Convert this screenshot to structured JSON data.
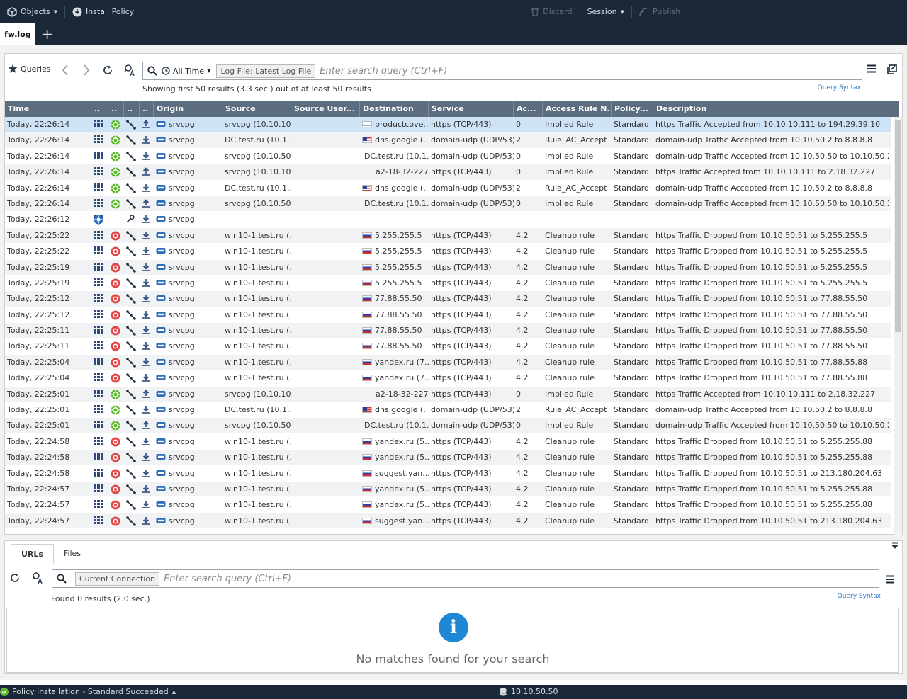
{
  "topbar": {
    "objects_label": "Objects",
    "install_policy_label": "Install Policy",
    "discard_label": "Discard",
    "session_label": "Session",
    "publish_label": "Publish"
  },
  "tab": {
    "name": "fw.log",
    "add": "+"
  },
  "toolbar": {
    "queries_label": "Queries",
    "time_filter": "All Time",
    "log_file_tag": "Log File: Latest Log File",
    "search_placeholder": "Enter search query (Ctrl+F)",
    "results_status": "Showing first 50 results (3.3 sec.) out of at least 50 results",
    "query_syntax_link": "Query Syntax"
  },
  "table": {
    "columns": [
      "Time",
      "..",
      "..",
      "..",
      "..",
      "Origin",
      "Source",
      "Source User...",
      "Destination",
      "Service",
      "Ac...",
      "Access Rule N...",
      "Policy...",
      "Description"
    ],
    "rows": [
      {
        "time": "Today, 22:26:14",
        "status": "accept",
        "dir": "up",
        "origin": "srvcpg",
        "source": "srvcpg (10.10.10....",
        "flag": "il",
        "destination": "productcove...",
        "service": "https (TCP/443)",
        "ac": "0",
        "rule": "Implied Rule",
        "policy": "Standard",
        "description": "https Traffic Accepted from 10.10.10.111 to 194.29.39.10"
      },
      {
        "time": "Today, 22:26:14",
        "status": "accept",
        "dir": "down",
        "origin": "srvcpg",
        "source": "DC.test.ru (10.1....",
        "flag": "us",
        "destination": "dns.google (...",
        "service": "domain-udp (UDP/53)",
        "ac": "2",
        "rule": "Rule_AC_Accept",
        "policy": "Standard",
        "description": "domain-udp Traffic Accepted from 10.10.50.2 to 8.8.8.8"
      },
      {
        "time": "Today, 22:26:14",
        "status": "accept",
        "dir": "down",
        "origin": "srvcpg",
        "source": "srvcpg (10.10.50....",
        "flag": "",
        "destination": "DC.test.ru (10.1....",
        "service": "domain-udp (UDP/53)",
        "ac": "0",
        "rule": "Implied Rule",
        "policy": "Standard",
        "description": "domain-udp Traffic Accepted from 10.10.50.50 to 10.10.50.2"
      },
      {
        "time": "Today, 22:26:14",
        "status": "accept",
        "dir": "up",
        "origin": "srvcpg",
        "source": "srvcpg (10.10.10....",
        "flag": "",
        "destination": "a2-18-32-227....",
        "service": "https (TCP/443)",
        "ac": "0",
        "rule": "Implied Rule",
        "policy": "Standard",
        "description": "https Traffic Accepted from 10.10.10.111 to 2.18.32.227"
      },
      {
        "time": "Today, 22:26:14",
        "status": "accept",
        "dir": "down",
        "origin": "srvcpg",
        "source": "DC.test.ru (10.1....",
        "flag": "us",
        "destination": "dns.google (...",
        "service": "domain-udp (UDP/53)",
        "ac": "2",
        "rule": "Rule_AC_Accept",
        "policy": "Standard",
        "description": "domain-udp Traffic Accepted from 10.10.50.2 to 8.8.8.8"
      },
      {
        "time": "Today, 22:26:14",
        "status": "accept",
        "dir": "up",
        "origin": "srvcpg",
        "source": "srvcpg (10.10.50....",
        "flag": "",
        "destination": "DC.test.ru (10.1....",
        "service": "domain-udp (UDP/53)",
        "ac": "0",
        "rule": "Implied Rule",
        "policy": "Standard",
        "description": "domain-udp Traffic Accepted from 10.10.50.50 to 10.10.50.2"
      },
      {
        "time": "Today, 22:26:12",
        "status": "system",
        "dir": "down",
        "origin": "srvcpg",
        "source": "",
        "flag": "",
        "destination": "",
        "service": "",
        "ac": "",
        "rule": "",
        "policy": "",
        "description": ""
      },
      {
        "time": "Today, 22:25:22",
        "status": "drop",
        "dir": "down",
        "origin": "srvcpg",
        "source": "win10-1.test.ru (...",
        "flag": "ru",
        "destination": "5.255.255.5",
        "service": "https (TCP/443)",
        "ac": "4.2",
        "rule": "Cleanup rule",
        "policy": "Standard",
        "description": "https Traffic Dropped from 10.10.50.51 to 5.255.255.5"
      },
      {
        "time": "Today, 22:25:22",
        "status": "drop",
        "dir": "down",
        "origin": "srvcpg",
        "source": "win10-1.test.ru (...",
        "flag": "ru",
        "destination": "5.255.255.5",
        "service": "https (TCP/443)",
        "ac": "4.2",
        "rule": "Cleanup rule",
        "policy": "Standard",
        "description": "https Traffic Dropped from 10.10.50.51 to 5.255.255.5"
      },
      {
        "time": "Today, 22:25:19",
        "status": "drop",
        "dir": "down",
        "origin": "srvcpg",
        "source": "win10-1.test.ru (...",
        "flag": "ru",
        "destination": "5.255.255.5",
        "service": "https (TCP/443)",
        "ac": "4.2",
        "rule": "Cleanup rule",
        "policy": "Standard",
        "description": "https Traffic Dropped from 10.10.50.51 to 5.255.255.5"
      },
      {
        "time": "Today, 22:25:19",
        "status": "drop",
        "dir": "down",
        "origin": "srvcpg",
        "source": "win10-1.test.ru (...",
        "flag": "ru",
        "destination": "5.255.255.5",
        "service": "https (TCP/443)",
        "ac": "4.2",
        "rule": "Cleanup rule",
        "policy": "Standard",
        "description": "https Traffic Dropped from 10.10.50.51 to 5.255.255.5"
      },
      {
        "time": "Today, 22:25:12",
        "status": "drop",
        "dir": "down",
        "origin": "srvcpg",
        "source": "win10-1.test.ru (...",
        "flag": "ru",
        "destination": "77.88.55.50",
        "service": "https (TCP/443)",
        "ac": "4.2",
        "rule": "Cleanup rule",
        "policy": "Standard",
        "description": "https Traffic Dropped from 10.10.50.51 to 77.88.55.50"
      },
      {
        "time": "Today, 22:25:12",
        "status": "drop",
        "dir": "down",
        "origin": "srvcpg",
        "source": "win10-1.test.ru (...",
        "flag": "ru",
        "destination": "77.88.55.50",
        "service": "https (TCP/443)",
        "ac": "4.2",
        "rule": "Cleanup rule",
        "policy": "Standard",
        "description": "https Traffic Dropped from 10.10.50.51 to 77.88.55.50"
      },
      {
        "time": "Today, 22:25:11",
        "status": "drop",
        "dir": "down",
        "origin": "srvcpg",
        "source": "win10-1.test.ru (...",
        "flag": "ru",
        "destination": "77.88.55.50",
        "service": "https (TCP/443)",
        "ac": "4.2",
        "rule": "Cleanup rule",
        "policy": "Standard",
        "description": "https Traffic Dropped from 10.10.50.51 to 77.88.55.50"
      },
      {
        "time": "Today, 22:25:11",
        "status": "drop",
        "dir": "down",
        "origin": "srvcpg",
        "source": "win10-1.test.ru (...",
        "flag": "ru",
        "destination": "77.88.55.50",
        "service": "https (TCP/443)",
        "ac": "4.2",
        "rule": "Cleanup rule",
        "policy": "Standard",
        "description": "https Traffic Dropped from 10.10.50.51 to 77.88.55.50"
      },
      {
        "time": "Today, 22:25:04",
        "status": "drop",
        "dir": "down",
        "origin": "srvcpg",
        "source": "win10-1.test.ru (...",
        "flag": "ru",
        "destination": "yandex.ru (7...",
        "service": "https (TCP/443)",
        "ac": "4.2",
        "rule": "Cleanup rule",
        "policy": "Standard",
        "description": "https Traffic Dropped from 10.10.50.51 to 77.88.55.88"
      },
      {
        "time": "Today, 22:25:04",
        "status": "drop",
        "dir": "down",
        "origin": "srvcpg",
        "source": "win10-1.test.ru (...",
        "flag": "ru",
        "destination": "yandex.ru (7...",
        "service": "https (TCP/443)",
        "ac": "4.2",
        "rule": "Cleanup rule",
        "policy": "Standard",
        "description": "https Traffic Dropped from 10.10.50.51 to 77.88.55.88"
      },
      {
        "time": "Today, 22:25:01",
        "status": "accept",
        "dir": "up",
        "origin": "srvcpg",
        "source": "srvcpg (10.10.10....",
        "flag": "",
        "destination": "a2-18-32-227....",
        "service": "https (TCP/443)",
        "ac": "0",
        "rule": "Implied Rule",
        "policy": "Standard",
        "description": "https Traffic Accepted from 10.10.10.111 to 2.18.32.227"
      },
      {
        "time": "Today, 22:25:01",
        "status": "accept",
        "dir": "down",
        "origin": "srvcpg",
        "source": "DC.test.ru (10.1....",
        "flag": "us",
        "destination": "dns.google (...",
        "service": "domain-udp (UDP/53)",
        "ac": "2",
        "rule": "Rule_AC_Accept",
        "policy": "Standard",
        "description": "domain-udp Traffic Accepted from 10.10.50.2 to 8.8.8.8"
      },
      {
        "time": "Today, 22:25:01",
        "status": "accept",
        "dir": "up",
        "origin": "srvcpg",
        "source": "srvcpg (10.10.50....",
        "flag": "",
        "destination": "DC.test.ru (10.1....",
        "service": "domain-udp (UDP/53)",
        "ac": "0",
        "rule": "Implied Rule",
        "policy": "Standard",
        "description": "domain-udp Traffic Accepted from 10.10.50.50 to 10.10.50.2"
      },
      {
        "time": "Today, 22:24:58",
        "status": "drop",
        "dir": "down",
        "origin": "srvcpg",
        "source": "win10-1.test.ru (...",
        "flag": "ru",
        "destination": "yandex.ru (5....",
        "service": "https (TCP/443)",
        "ac": "4.2",
        "rule": "Cleanup rule",
        "policy": "Standard",
        "description": "https Traffic Dropped from 10.10.50.51 to 5.255.255.88"
      },
      {
        "time": "Today, 22:24:58",
        "status": "drop",
        "dir": "down",
        "origin": "srvcpg",
        "source": "win10-1.test.ru (...",
        "flag": "ru",
        "destination": "yandex.ru (5....",
        "service": "https (TCP/443)",
        "ac": "4.2",
        "rule": "Cleanup rule",
        "policy": "Standard",
        "description": "https Traffic Dropped from 10.10.50.51 to 5.255.255.88"
      },
      {
        "time": "Today, 22:24:58",
        "status": "drop",
        "dir": "down",
        "origin": "srvcpg",
        "source": "win10-1.test.ru (...",
        "flag": "ru",
        "destination": "suggest.yan...",
        "service": "https (TCP/443)",
        "ac": "4.2",
        "rule": "Cleanup rule",
        "policy": "Standard",
        "description": "https Traffic Dropped from 10.10.50.51 to 213.180.204.63"
      },
      {
        "time": "Today, 22:24:57",
        "status": "drop",
        "dir": "down",
        "origin": "srvcpg",
        "source": "win10-1.test.ru (...",
        "flag": "ru",
        "destination": "yandex.ru (5....",
        "service": "https (TCP/443)",
        "ac": "4.2",
        "rule": "Cleanup rule",
        "policy": "Standard",
        "description": "https Traffic Dropped from 10.10.50.51 to 5.255.255.88"
      },
      {
        "time": "Today, 22:24:57",
        "status": "drop",
        "dir": "down",
        "origin": "srvcpg",
        "source": "win10-1.test.ru (...",
        "flag": "ru",
        "destination": "yandex.ru (5....",
        "service": "https (TCP/443)",
        "ac": "4.2",
        "rule": "Cleanup rule",
        "policy": "Standard",
        "description": "https Traffic Dropped from 10.10.50.51 to 5.255.255.88"
      },
      {
        "time": "Today, 22:24:57",
        "status": "drop",
        "dir": "down",
        "origin": "srvcpg",
        "source": "win10-1.test.ru (...",
        "flag": "ru",
        "destination": "suggest.yan...",
        "service": "https (TCP/443)",
        "ac": "4.2",
        "rule": "Cleanup rule",
        "policy": "Standard",
        "description": "https Traffic Dropped from 10.10.50.51 to 213.180.204.63"
      }
    ]
  },
  "bottom": {
    "tabs": [
      "URLs",
      "Files"
    ],
    "connection_tag": "Current Connection",
    "search_placeholder": "Enter search query (Ctrl+F)",
    "found_status": "Found 0 results (2.0 sec.)",
    "query_syntax_link": "Query Syntax",
    "empty_message": "No matches found for your search"
  },
  "statusbar": {
    "policy_status": "Policy installation - Standard Succeeded",
    "server": "10.10.50.50"
  },
  "colors": {
    "chrome": "#1b2838",
    "header": "#5c6d80",
    "accept": "#5fb832",
    "drop": "#e24646",
    "link": "#2a7ecb",
    "selected_row": "#cfe3f7"
  }
}
